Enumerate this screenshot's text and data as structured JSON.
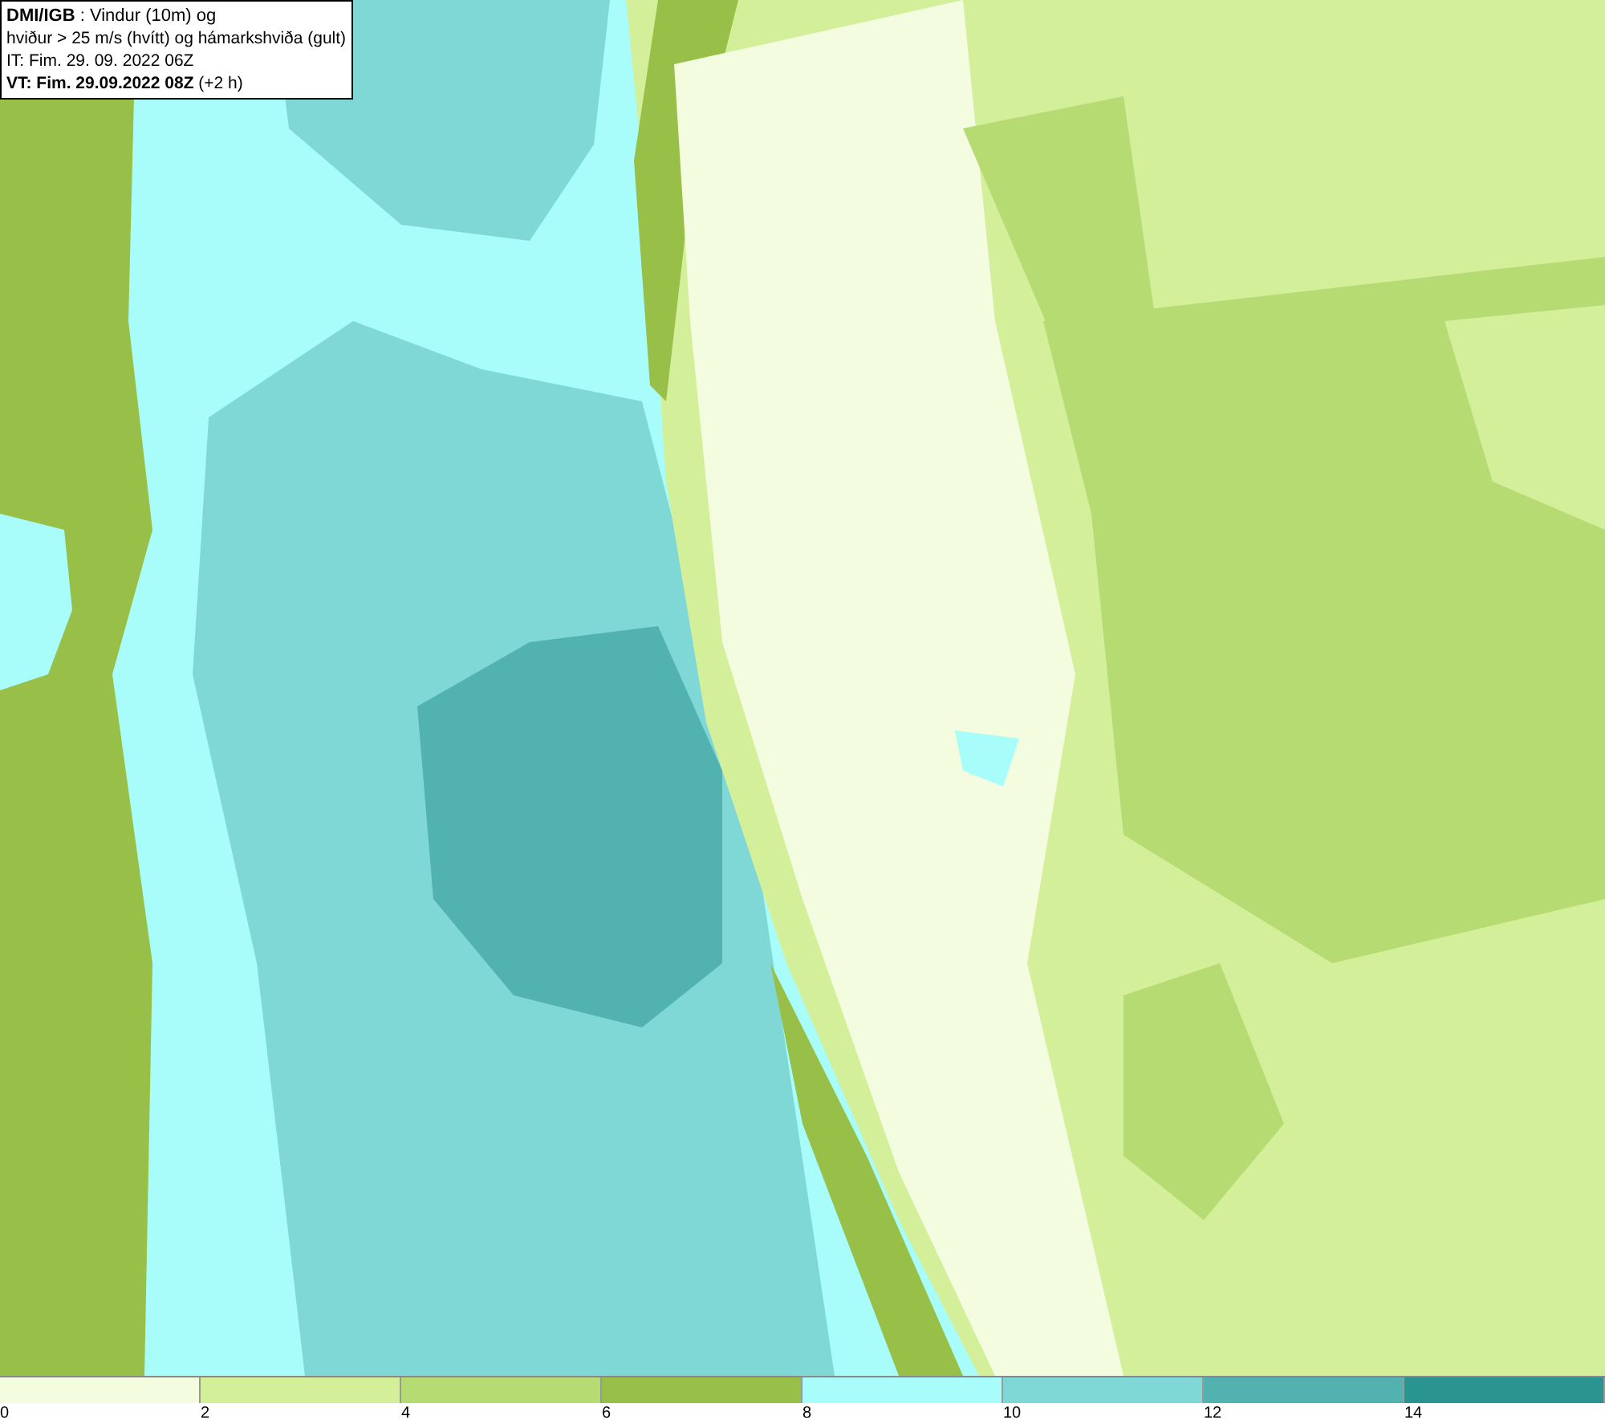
{
  "caption": {
    "lines": [
      "**DMI/IGB** : Vindur (10m) og",
      "hviður > 25 m/s (hvítt) og hámarkshviða (gult)",
      "IT: Fim. 29. 09. 2022 06Z",
      "**VT: Fim. 29.09.2022 08Z** (+2 h)"
    ]
  },
  "legend": [
    {
      "color": "#f4fce0",
      "label": "0"
    },
    {
      "color": "#d4ef9a",
      "label": "2"
    },
    {
      "color": "#b6db72",
      "label": "4"
    },
    {
      "color": "#98bf48",
      "label": "6"
    },
    {
      "color": "#a8fcfa",
      "label": "8"
    },
    {
      "color": "#80d8d6",
      "label": "10"
    },
    {
      "color": "#52b2b0",
      "label": "12"
    },
    {
      "color": "#2a9490",
      "label": "14"
    }
  ]
}
